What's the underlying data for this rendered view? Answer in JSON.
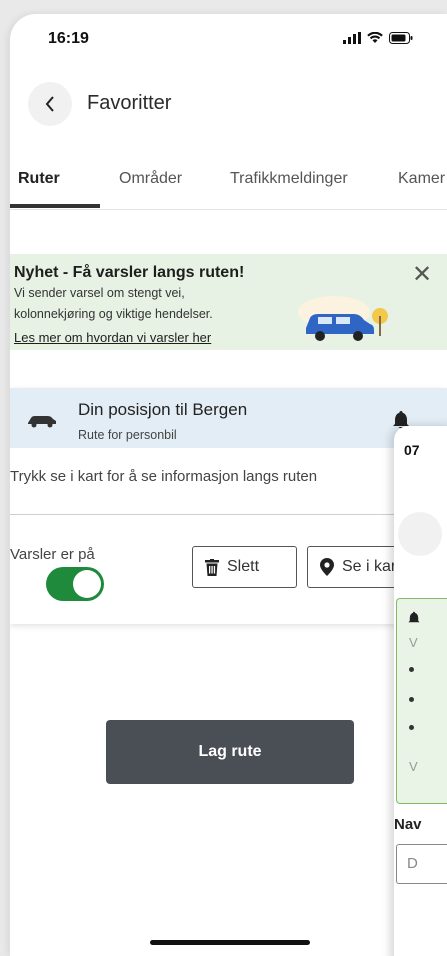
{
  "status_bar": {
    "time": "16:19"
  },
  "header": {
    "title": "Favoritter"
  },
  "tabs": [
    {
      "label": "Ruter",
      "active": true
    },
    {
      "label": "Områder",
      "active": false
    },
    {
      "label": "Trafikkmeldinger",
      "active": false
    },
    {
      "label": "Kamer",
      "active": false
    }
  ],
  "banner": {
    "title": "Nyhet - Få varsler langs ruten!",
    "line1": "Vi sender varsel om stengt vei,",
    "line2": "kolonnekjøring og viktige hendelser.",
    "link": "Les mer om hvordan vi varsler her"
  },
  "route_card": {
    "title": "Din posisjon til Bergen",
    "subtitle": "Rute for personbil",
    "hint": "Trykk se i kart for å se informasjon langs ruten",
    "notifications_label": "Varsler er på",
    "notifications_on": true,
    "delete_label": "Slett",
    "map_label": "Se i kart"
  },
  "primary_button": {
    "label": "Lag rute"
  },
  "overlay_panel": {
    "time": "07",
    "name_label": "Nav",
    "input_placeholder": "D",
    "green_letter": "V"
  },
  "colors": {
    "toggle_on": "#1f8a3b",
    "banner_bg": "#e7f2e4",
    "card_header_bg": "#e3edf5",
    "primary_button_bg": "#4a4f55"
  }
}
